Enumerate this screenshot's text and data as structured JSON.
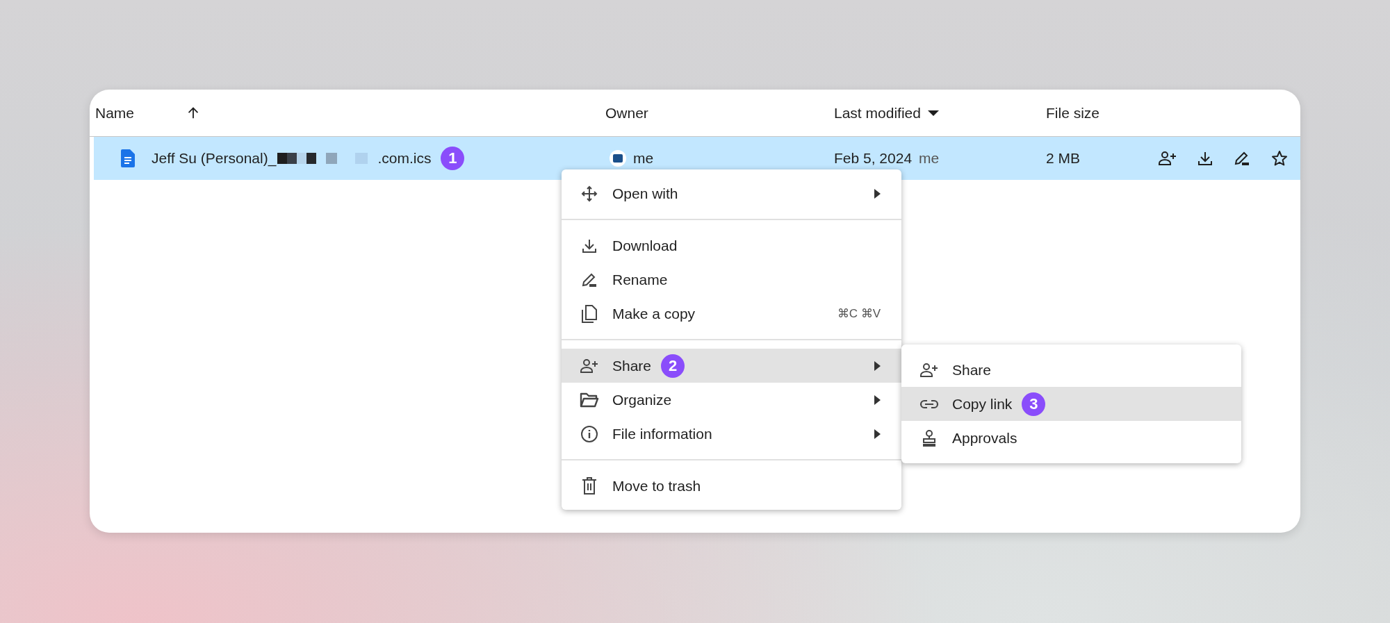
{
  "table": {
    "columns": [
      {
        "label": "Name",
        "sorted": true,
        "ascending": true
      },
      {
        "label": "Owner",
        "sorted": false
      },
      {
        "label": "Last modified",
        "sorted": true,
        "ascending": false
      },
      {
        "label": "File size",
        "sorted": false
      }
    ],
    "rows": [
      {
        "selected": true,
        "name_start": "Jeff Su (Personal)_",
        "name_end": ".com.ics",
        "badge": "1",
        "owner": "me",
        "modified": "Feb 5, 2024",
        "modified_by": "me",
        "size": "2 MB"
      }
    ]
  },
  "menu": {
    "groups": [
      [
        {
          "label": "Open with",
          "submenu": true,
          "selected": false
        }
      ],
      [
        {
          "label": "Download",
          "submenu": false,
          "selected": false
        },
        {
          "label": "Rename",
          "submenu": false,
          "selected": false
        },
        {
          "label": "Make a copy",
          "submenu": false,
          "selected": false,
          "shortcut": "⌘C ⌘V"
        }
      ],
      [
        {
          "label": "Share",
          "submenu": true,
          "selected": true,
          "badge": "2"
        },
        {
          "label": "Organize",
          "submenu": true,
          "selected": false
        },
        {
          "label": "File information",
          "submenu": true,
          "selected": false
        }
      ],
      [
        {
          "label": "Move to trash",
          "submenu": false,
          "selected": false
        }
      ]
    ]
  },
  "submenu": {
    "items": [
      {
        "label": "Share",
        "selected": false
      },
      {
        "label": "Copy link",
        "selected": true,
        "badge": "3"
      },
      {
        "label": "Approvals",
        "selected": false
      }
    ]
  }
}
